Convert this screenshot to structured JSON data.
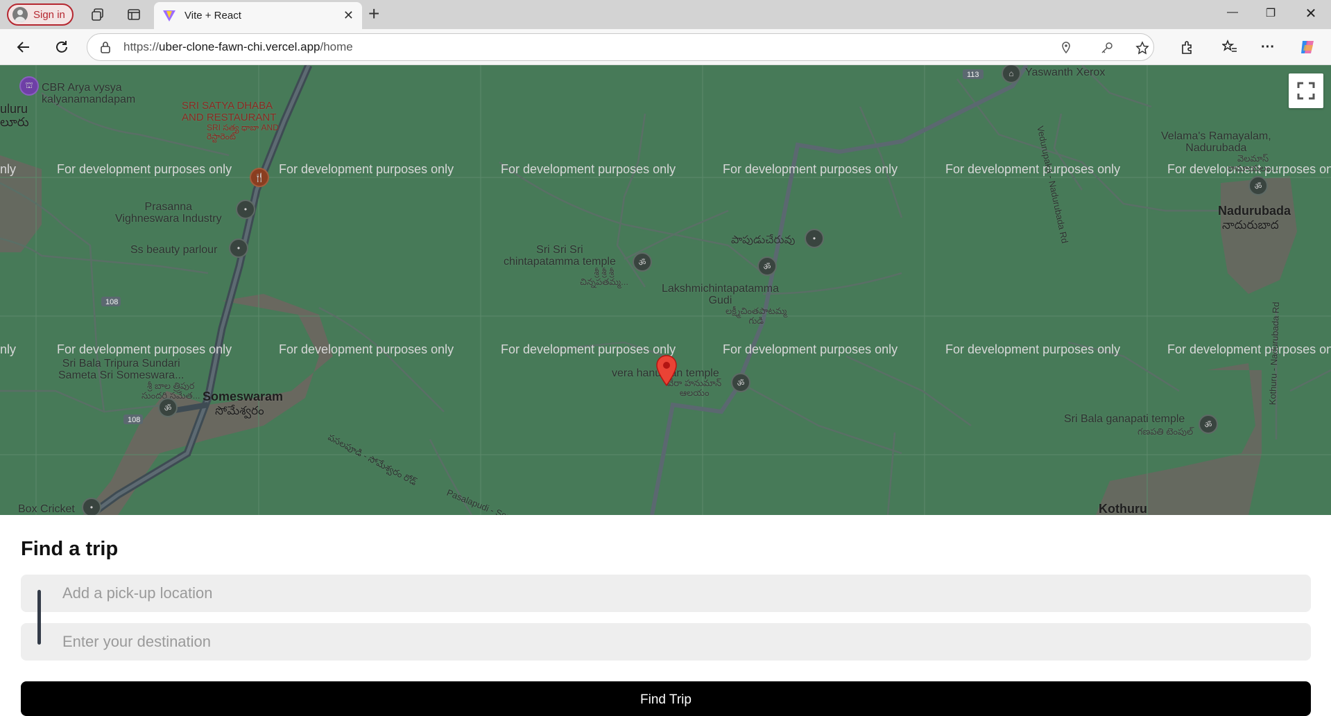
{
  "browser": {
    "signin_label": "Sign in",
    "tab_title": "Vite + React",
    "url_scheme": "https://",
    "url_host": "uber-clone-fawn-chi.vercel.app",
    "url_path": "/home"
  },
  "map": {
    "watermark": "For development purposes only",
    "labels": {
      "yaswanth": "Yaswanth Xerox",
      "road113": "113",
      "cbr": "CBR Arya vysya\nkalyanamandapam",
      "satya": "SRI SATYA DHABA\nAND RESTAURANT",
      "satya_te": "SRI సత్య ధాబా AND\nరెస్టారెంట్",
      "uluru": "uluru\nలూరు",
      "prasanna": "Prasanna\nVighneswara Industry",
      "road108a": "108",
      "beauty": "Ss beauty parlour",
      "tripura": "Sri Bala Tripura Sundari\nSameta Sri Someswara...",
      "tripura_te": "శ్రీ బాల త్రిపుర\nసుందరి సమేత...",
      "someswaram": "Someswaram",
      "someswaram_te": "సోమేశ్వరం",
      "road108b": "108",
      "boxcricket": "Box Cricket",
      "chintapatamma": "Sri Sri Sri\nchintapatamma temple",
      "chintapatamma_te": "శ్రీ శ్రీ శ్రీ\nచిన్నపతమ్మ...",
      "papudu": "పాపుడుచేరువు",
      "lakshmi": "Lakshmichintapatamma\nGudi",
      "lakshmi_te": "లక్ష్మీచింతపాటమ్మ\nగుడి",
      "hanuman": "vera hanuman temple",
      "hanuman_te": "వేరా హనుమాన్\nఆలయం",
      "road_te": "పసలపూడి - సోమేశ్వరం రోడ్",
      "pasalapudi": "Pasalapudi - Som...",
      "velama": "Velama's Ramayalam,\nNadurubada",
      "velama_te": "వెలమాస్\nరామాయలం...",
      "nadurubada": "Nadurubada",
      "nadurubada_te": "నాదురుబాద",
      "vedurupaka_rd": "Vedurupaka - Nadurubada Rd",
      "kothuru_rd": "Kothuru - Nadurubada Rd",
      "ganapati": "Sri Bala ganapati temple",
      "ganapati_te": "గణపతి టెంపుల్",
      "kothuru": "Kothuru"
    }
  },
  "trip": {
    "title": "Find a trip",
    "pickup_placeholder": "Add a pick-up location",
    "destination_placeholder": "Enter your destination",
    "button_label": "Find Trip"
  },
  "colors": {
    "map_bg": "#477a58",
    "button_bg": "#000000",
    "input_bg": "#eeeeee",
    "signin_accent": "#b5262f"
  }
}
